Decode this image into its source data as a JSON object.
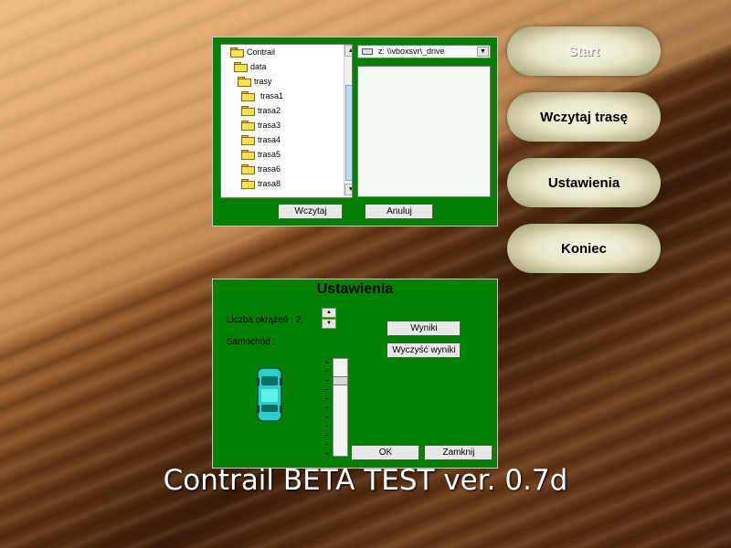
{
  "file_dialog": {
    "tree": [
      {
        "label": "Contrail",
        "open": true
      },
      {
        "label": "data",
        "open": true
      },
      {
        "label": "trasy",
        "open": true
      },
      {
        "label": "trasa1",
        "selected": true
      },
      {
        "label": "trasa2"
      },
      {
        "label": "trasa3"
      },
      {
        "label": "trasa4"
      },
      {
        "label": "trasa5"
      },
      {
        "label": "trasa6"
      },
      {
        "label": "trasa8"
      }
    ],
    "drive": "z: \\\\vboxsvr\\_drive",
    "load_button": "Wczytaj",
    "cancel_button": "Anuluj"
  },
  "settings": {
    "title": "Ustawienia",
    "laps_label": "Liczba okrążeń : 2",
    "car_label": "Samochód :",
    "results_button": "Wyniki",
    "clear_results_button": "Wyczyść wyniki",
    "ok_button": "OK",
    "close_button": "Zamknij",
    "car_color": "#2ad0c8"
  },
  "menu": {
    "start": "Start",
    "load_track": "Wczytaj trasę",
    "settings": "Ustawienia",
    "exit": "Koniec"
  },
  "footer": "Contrail BETA TEST ver. 0.7d"
}
